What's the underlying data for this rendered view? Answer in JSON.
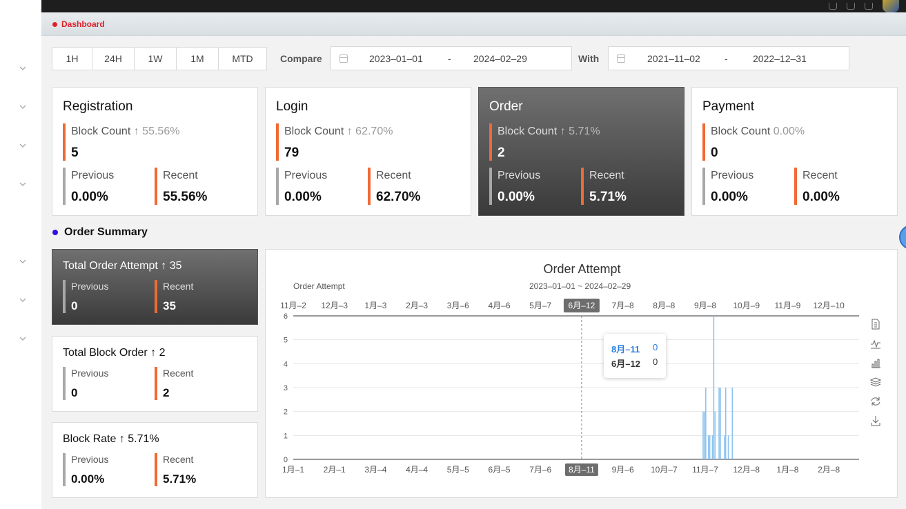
{
  "tab": {
    "label": "Dashboard"
  },
  "filters": {
    "ranges": [
      "1H",
      "24H",
      "1W",
      "1M",
      "MTD"
    ],
    "compare_label": "Compare",
    "compare_start": "2023–01–01",
    "compare_sep": "-",
    "compare_end": "2024–02–29",
    "with_label": "With",
    "with_start": "2021–11–02",
    "with_sep": "-",
    "with_end": "2022–12–31"
  },
  "metrics": [
    {
      "title": "Registration",
      "block_label": "Block Count",
      "arrow": "↑",
      "change": "55.56%",
      "count": "5",
      "previous_label": "Previous",
      "previous": "0.00%",
      "recent_label": "Recent",
      "recent": "55.56%"
    },
    {
      "title": "Login",
      "block_label": "Block Count",
      "arrow": "↑",
      "change": "62.70%",
      "count": "79",
      "previous_label": "Previous",
      "previous": "0.00%",
      "recent_label": "Recent",
      "recent": "62.70%"
    },
    {
      "title": "Order",
      "block_label": "Block Count",
      "arrow": "↑",
      "change": "5.71%",
      "count": "2",
      "previous_label": "Previous",
      "previous": "0.00%",
      "recent_label": "Recent",
      "recent": "5.71%"
    },
    {
      "title": "Payment",
      "block_label": "Block Count",
      "arrow": "",
      "change": "0.00%",
      "count": "0",
      "previous_label": "Previous",
      "previous": "0.00%",
      "recent_label": "Recent",
      "recent": "0.00%"
    }
  ],
  "order_summary": {
    "heading": "Order Summary",
    "cards": [
      {
        "title": "Total Order Attempt",
        "arrow": "↑",
        "value": "35",
        "previous_label": "Previous",
        "previous": "0",
        "recent_label": "Recent",
        "recent": "35"
      },
      {
        "title": "Total Block Order",
        "arrow": "↑",
        "value": "2",
        "previous_label": "Previous",
        "previous": "0",
        "recent_label": "Recent",
        "recent": "2"
      },
      {
        "title": "Block Rate",
        "arrow": "↑",
        "value": "5.71%",
        "previous_label": "Previous",
        "previous": "0.00%",
        "recent_label": "Recent",
        "recent": "5.71%"
      }
    ]
  },
  "chart_data": {
    "type": "bar",
    "title": "Order Attempt",
    "subtitle": "2023–01–01 ~ 2024–02–29",
    "legend": [
      "Order Attempt"
    ],
    "ylim": [
      0,
      6
    ],
    "yticks": [
      0,
      1,
      2,
      3,
      4,
      5,
      6
    ],
    "x_ticks_bottom": [
      "1月–1",
      "2月–1",
      "3月–4",
      "4月–4",
      "5月–5",
      "6月–5",
      "7月–6",
      "8月–11",
      "9月–6",
      "10月–7",
      "11月–7",
      "12月–8",
      "1月–8",
      "2月–8"
    ],
    "x_ticks_top": [
      "11月–2",
      "12月–3",
      "1月–3",
      "2月–3",
      "3月–6",
      "4月–6",
      "5月–7",
      "6月–12",
      "7月–8",
      "8月–8",
      "9月–8",
      "10月–9",
      "11月–9",
      "12月–10"
    ],
    "highlight_bottom": "8月–11",
    "highlight_top": "6月–12",
    "series": [
      {
        "name": "",
        "x": [
          "11月–5",
          "11月–6",
          "11月–7",
          "11月–9",
          "11月–10",
          "11月–12",
          "11月–13",
          "11月–14",
          "11月–17",
          "11月–18",
          "11月–21",
          "11月–22",
          "11月–24",
          "11月–27"
        ],
        "values": [
          2,
          2,
          3,
          1,
          1,
          1,
          6,
          2,
          3,
          3,
          1,
          3,
          1,
          3
        ]
      }
    ],
    "tooltip": [
      {
        "label": "8月–11",
        "value": "0"
      },
      {
        "label": "6月–12",
        "value": "0"
      }
    ],
    "colors": {
      "series": "#8ec3f0",
      "axis": "#333333",
      "grid": "#e6e6e6"
    }
  }
}
